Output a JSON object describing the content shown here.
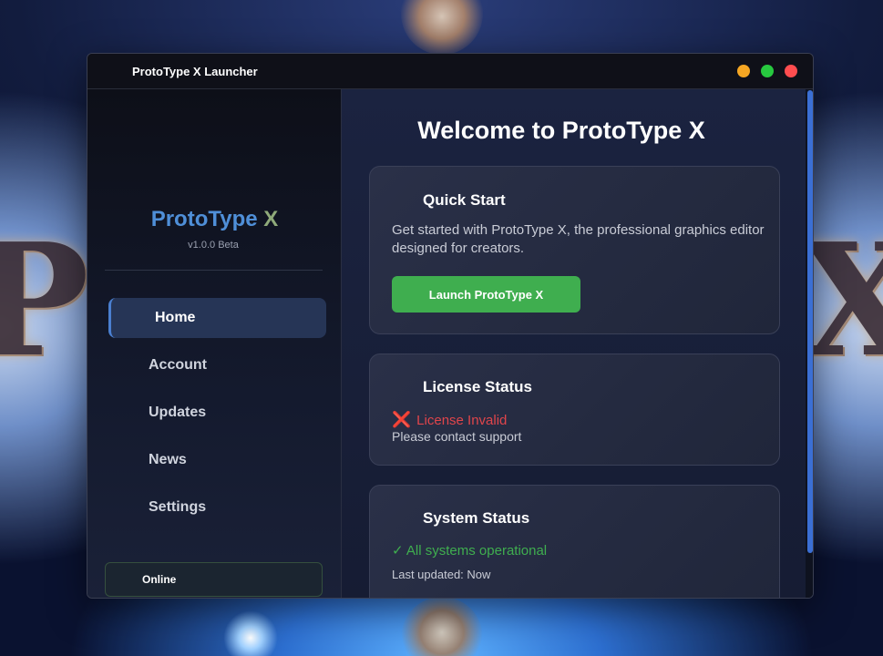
{
  "background": {
    "letter_left": "P",
    "letter_right": "X"
  },
  "window": {
    "title": "ProtoType X Launcher"
  },
  "sidebar": {
    "brand_part1": "ProtoType",
    "brand_part2": "X",
    "version": "v1.0.0 Beta",
    "items": [
      {
        "label": "Home",
        "active": true
      },
      {
        "label": "Account",
        "active": false
      },
      {
        "label": "Updates",
        "active": false
      },
      {
        "label": "News",
        "active": false
      },
      {
        "label": "Settings",
        "active": false
      }
    ],
    "status": "Online"
  },
  "main": {
    "welcome": "Welcome to ProtoType X",
    "quick_start": {
      "title": "Quick Start",
      "description": "Get started with ProtoType X, the professional graphics editor designed for creators.",
      "button": "Launch ProtoType X"
    },
    "license": {
      "title": "License Status",
      "icon": "❌",
      "status": "License Invalid",
      "note": "Please contact support"
    },
    "system": {
      "title": "System Status",
      "status": "✓ All systems operational",
      "updated": "Last updated: Now"
    }
  },
  "colors": {
    "accent_blue": "#4f8fd8",
    "accent_green": "#3fae4f",
    "error_red": "#e0454b",
    "window_min": "#f5a623",
    "window_max": "#27c93f",
    "window_close": "#ff4d4f"
  }
}
